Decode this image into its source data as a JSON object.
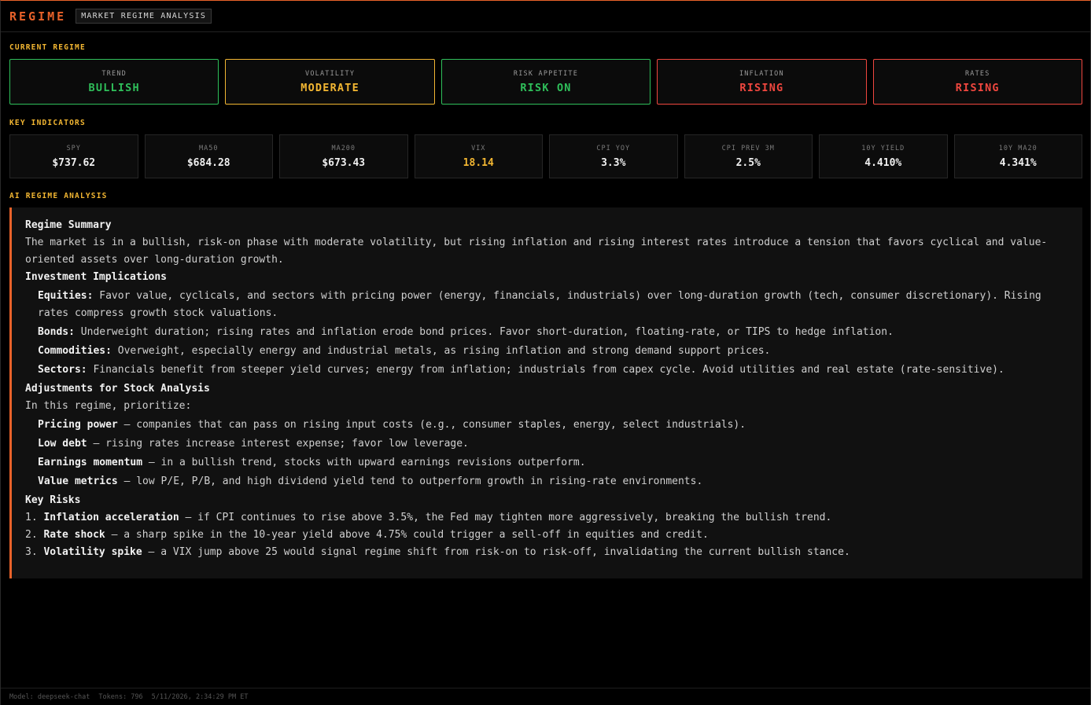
{
  "header": {
    "brand": "REGIME",
    "tag": "MARKET REGIME ANALYSIS"
  },
  "sections": {
    "current_regime": "CURRENT REGIME",
    "key_indicators": "KEY INDICATORS",
    "ai_analysis": "AI REGIME ANALYSIS"
  },
  "regime": [
    {
      "label": "TREND",
      "value": "BULLISH",
      "color": "#2fbf5a"
    },
    {
      "label": "VOLATILITY",
      "value": "MODERATE",
      "color": "#f2b632"
    },
    {
      "label": "RISK APPETITE",
      "value": "RISK ON",
      "color": "#2fbf5a"
    },
    {
      "label": "INFLATION",
      "value": "RISING",
      "color": "#f0473f"
    },
    {
      "label": "RATES",
      "value": "RISING",
      "color": "#f0473f"
    }
  ],
  "indicators": [
    {
      "label": "SPY",
      "value": "$737.62"
    },
    {
      "label": "MA50",
      "value": "$684.28"
    },
    {
      "label": "MA200",
      "value": "$673.43"
    },
    {
      "label": "VIX",
      "value": "18.14",
      "color": "#f2b632"
    },
    {
      "label": "CPI YOY",
      "value": "3.3%"
    },
    {
      "label": "CPI PREV 3M",
      "value": "2.5%"
    },
    {
      "label": "10Y YIELD",
      "value": "4.410%"
    },
    {
      "label": "10Y MA20",
      "value": "4.341%"
    }
  ],
  "analysis": {
    "summary_title": "Regime Summary",
    "summary_text": "The market is in a bullish, risk-on phase with moderate volatility, but rising inflation and rising interest rates introduce a tension that favors cyclical and value-oriented assets over long-duration growth.",
    "implications_title": "Investment Implications",
    "implications": [
      {
        "term": "Equities:",
        "text": " Favor value, cyclicals, and sectors with pricing power (energy, financials, industrials) over long-duration growth (tech, consumer discretionary). Rising rates compress growth stock valuations."
      },
      {
        "term": "Bonds:",
        "text": " Underweight duration; rising rates and inflation erode bond prices. Favor short-duration, floating-rate, or TIPS to hedge inflation."
      },
      {
        "term": "Commodities:",
        "text": " Overweight, especially energy and industrial metals, as rising inflation and strong demand support prices."
      },
      {
        "term": "Sectors:",
        "text": " Financials benefit from steeper yield curves; energy from inflation; industrials from capex cycle. Avoid utilities and real estate (rate-sensitive)."
      }
    ],
    "adjustments_title": "Adjustments for Stock Analysis",
    "adjustments_intro": "In this regime, prioritize:",
    "adjustments": [
      {
        "term": "Pricing power",
        "text": " – companies that can pass on rising input costs (e.g., consumer staples, energy, select industrials)."
      },
      {
        "term": "Low debt",
        "text": " – rising rates increase interest expense; favor low leverage."
      },
      {
        "term": "Earnings momentum",
        "text": " – in a bullish trend, stocks with upward earnings revisions outperform."
      },
      {
        "term": "Value metrics",
        "text": " – low P/E, P/B, and high dividend yield tend to outperform growth in rising-rate environments."
      }
    ],
    "risks_title": "Key Risks",
    "risks": [
      {
        "num": "1.",
        "term": "Inflation acceleration",
        "text": " – if CPI continues to rise above 3.5%, the Fed may tighten more aggressively, breaking the bullish trend."
      },
      {
        "num": "2.",
        "term": "Rate shock",
        "text": " – a sharp spike in the 10-year yield above 4.75% could trigger a sell-off in equities and credit."
      },
      {
        "num": "3.",
        "term": "Volatility spike",
        "text": " – a VIX jump above 25 would signal regime shift from risk-on to risk-off, invalidating the current bullish stance."
      }
    ]
  },
  "footer": {
    "model": "Model: deepseek-chat",
    "tokens": "Tokens: 796",
    "timestamp": "5/11/2026, 2:34:29 PM ET"
  },
  "colors": {
    "accent": "#e8622a",
    "section_label": "#f2b632",
    "bull": "#2fbf5a",
    "warn": "#f2b632",
    "bear": "#f0473f"
  }
}
